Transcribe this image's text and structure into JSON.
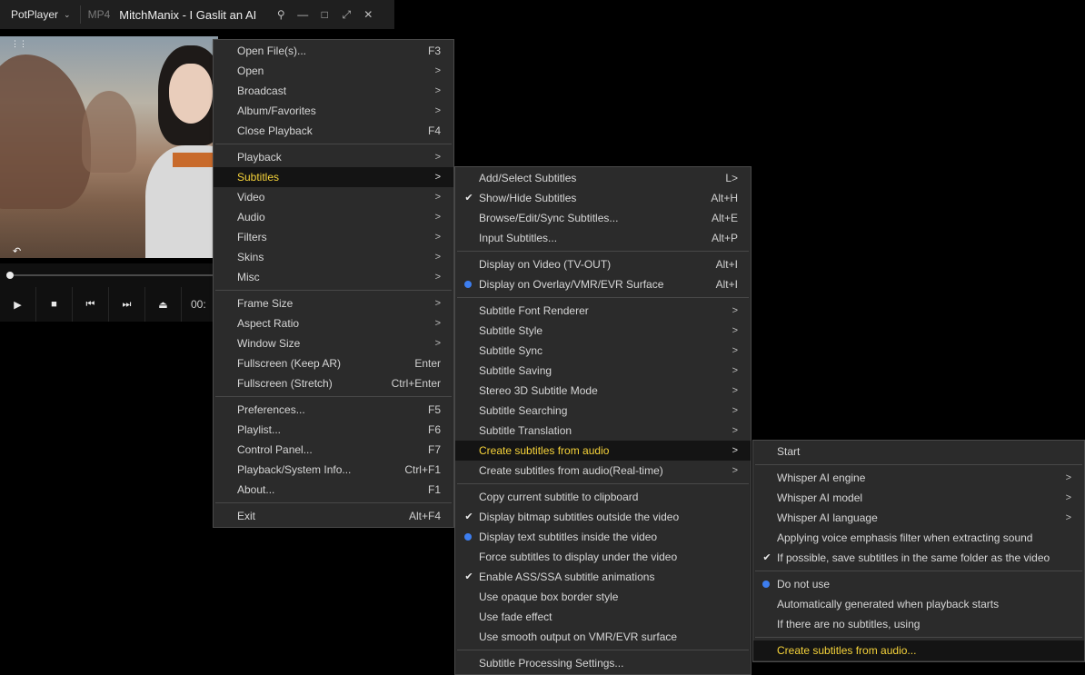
{
  "titlebar": {
    "app_name": "PotPlayer",
    "format": "MP4",
    "title": "MitchManix - I Gaslit an AI"
  },
  "controls": {
    "time": "00:"
  },
  "main_menu": [
    {
      "label": "Open File(s)...",
      "shortcut": "F3"
    },
    {
      "label": "Open",
      "arrow": ">"
    },
    {
      "label": "Broadcast",
      "arrow": ">"
    },
    {
      "label": "Album/Favorites",
      "arrow": ">"
    },
    {
      "label": "Close Playback",
      "shortcut": "F4"
    },
    {
      "sep": true
    },
    {
      "label": "Playback",
      "arrow": ">"
    },
    {
      "label": "Subtitles",
      "arrow": ">",
      "highlight": true
    },
    {
      "label": "Video",
      "arrow": ">"
    },
    {
      "label": "Audio",
      "arrow": ">"
    },
    {
      "label": "Filters",
      "arrow": ">"
    },
    {
      "label": "Skins",
      "arrow": ">"
    },
    {
      "label": "Misc",
      "arrow": ">"
    },
    {
      "sep": true
    },
    {
      "label": "Frame Size",
      "arrow": ">"
    },
    {
      "label": "Aspect Ratio",
      "arrow": ">"
    },
    {
      "label": "Window Size",
      "arrow": ">"
    },
    {
      "label": "Fullscreen (Keep AR)",
      "shortcut": "Enter"
    },
    {
      "label": "Fullscreen (Stretch)",
      "shortcut": "Ctrl+Enter"
    },
    {
      "sep": true
    },
    {
      "label": "Preferences...",
      "shortcut": "F5"
    },
    {
      "label": "Playlist...",
      "shortcut": "F6"
    },
    {
      "label": "Control Panel...",
      "shortcut": "F7"
    },
    {
      "label": "Playback/System Info...",
      "shortcut": "Ctrl+F1"
    },
    {
      "label": "About...",
      "shortcut": "F1"
    },
    {
      "sep": true
    },
    {
      "label": "Exit",
      "shortcut": "Alt+F4"
    }
  ],
  "subtitles_menu": [
    {
      "label": "Add/Select Subtitles",
      "shortcut": "L>"
    },
    {
      "label": "Show/Hide Subtitles",
      "shortcut": "Alt+H",
      "check": true
    },
    {
      "label": "Browse/Edit/Sync Subtitles...",
      "shortcut": "Alt+E"
    },
    {
      "label": "Input Subtitles...",
      "shortcut": "Alt+P"
    },
    {
      "sep": true
    },
    {
      "label": "Display on Video (TV-OUT)",
      "shortcut": "Alt+I"
    },
    {
      "label": "Display on Overlay/VMR/EVR Surface",
      "shortcut": "Alt+I",
      "radio": true
    },
    {
      "sep": true
    },
    {
      "label": "Subtitle Font Renderer",
      "arrow": ">"
    },
    {
      "label": "Subtitle Style",
      "arrow": ">"
    },
    {
      "label": "Subtitle Sync",
      "arrow": ">"
    },
    {
      "label": "Subtitle Saving",
      "arrow": ">"
    },
    {
      "label": "Stereo 3D Subtitle Mode",
      "arrow": ">"
    },
    {
      "label": "Subtitle Searching",
      "arrow": ">"
    },
    {
      "label": "Subtitle Translation",
      "arrow": ">"
    },
    {
      "label": "Create subtitles from audio",
      "arrow": ">",
      "highlight": true
    },
    {
      "label": "Create subtitles from audio(Real-time)",
      "arrow": ">"
    },
    {
      "sep": true
    },
    {
      "label": "Copy current subtitle to clipboard"
    },
    {
      "label": "Display bitmap subtitles outside the video",
      "check": true
    },
    {
      "label": "Display text subtitles inside the video",
      "radio": true
    },
    {
      "label": "Force subtitles to display under the video"
    },
    {
      "label": "Enable ASS/SSA subtitle animations",
      "check": true
    },
    {
      "label": "Use opaque box border style"
    },
    {
      "label": "Use fade effect"
    },
    {
      "label": "Use smooth output on VMR/EVR surface"
    },
    {
      "sep": true
    },
    {
      "label": "Subtitle Processing Settings..."
    }
  ],
  "create_menu": [
    {
      "label": "Start"
    },
    {
      "sep": true
    },
    {
      "label": "Whisper AI engine",
      "arrow": ">"
    },
    {
      "label": "Whisper AI model",
      "arrow": ">"
    },
    {
      "label": "Whisper AI language",
      "arrow": ">"
    },
    {
      "label": "Applying voice emphasis filter when extracting sound"
    },
    {
      "label": "If possible, save subtitles in the same folder as the video",
      "check": true
    },
    {
      "sep": true
    },
    {
      "label": "Do not use",
      "radio": true
    },
    {
      "label": "Automatically generated when playback starts"
    },
    {
      "label": "If there are no subtitles, using"
    },
    {
      "sep": true
    },
    {
      "label": "Create subtitles from audio...",
      "highlight": true
    }
  ]
}
